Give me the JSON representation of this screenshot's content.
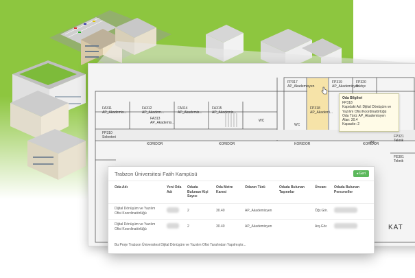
{
  "plan": {
    "rooms": [
      {
        "id": "fp317",
        "code": "FP317",
        "type": "AP_Akademisyen"
      },
      {
        "id": "fp318",
        "code": "FP318",
        "type": "AP_Akademisyen"
      },
      {
        "id": "fp319",
        "code": "FP319",
        "type": "AP_Akademisyen"
      },
      {
        "id": "fp320",
        "code": "FP320",
        "type": "Büdçe"
      },
      {
        "id": "fa311",
        "code": "FA311",
        "type": "AP_Akademis..."
      },
      {
        "id": "fa312",
        "code": "FA312",
        "type": "AP_Akadem..."
      },
      {
        "id": "fa313",
        "code": "FA313",
        "type": "AP_Akademis..."
      },
      {
        "id": "fa314",
        "code": "FA314",
        "type": "AP_Akademis..."
      },
      {
        "id": "fa315",
        "code": "FA315",
        "type": "AP_Akademis..."
      },
      {
        "id": "fp310",
        "code": "FP310",
        "type": "Sekreteri"
      },
      {
        "id": "fp321",
        "code": "FP321",
        "type": "Teknik"
      },
      {
        "id": "fe301",
        "code": "FE301",
        "type": "Teknik"
      }
    ],
    "selected": {
      "id": "fp318",
      "code": "FP318",
      "type": "AP_Akademi..."
    },
    "corridors": [
      "KORIDOR",
      "KORIDOR",
      "KORIDOR",
      "KORIDOR"
    ],
    "wc_labels": [
      "WC",
      "WC",
      "WC"
    ],
    "floor_label": "KAT"
  },
  "tooltip": {
    "title": "Oda Bilgileri",
    "lines": [
      "FP318",
      "Kapıdaki Ad: Dijital Dönüşüm ve",
      "Yazılım Ofisi Koordinatörlüğü",
      "Oda Türü: AP_Akademisyen",
      "Alan: 30.4",
      "Kapasite: 2"
    ]
  },
  "card": {
    "title": "Trabzon Üniversitesi Fatih Kampüsü",
    "button": "Geri",
    "columns": [
      "Oda Adı",
      "Yeni Oda Adı",
      "Odada Bulunan Kişi Sayısı",
      "Oda Metre Karesi",
      "Odanın Türü",
      "Odada Bulunan Taşınırlar",
      "Ünvanı",
      "Odada Bulunan Personeller"
    ],
    "rows": [
      {
        "oda_adi": "Dijital Dönüşüm ve Yazılım Ofisi Koordinatörlüğü",
        "kisi": "2",
        "metre": "30.40",
        "tur": "AP_Akademisyen",
        "unvan": "Öğr.Gör."
      },
      {
        "oda_adi": "Dijital Dönüşüm ve Yazılım Ofisi Koordinatörlüğü",
        "kisi": "2",
        "metre": "30.40",
        "tur": "AP_Akademisyen",
        "unvan": "Arş.Gör."
      }
    ],
    "footer": "Bu Proje Trabzon Üniversitesi Dijital Dönüşüm ve Yazılım Ofisi Tarafından Yapılmıştır..."
  },
  "colors": {
    "brand_green": "#8dc63f",
    "button_green": "#5cb85c",
    "selected_room": "#f6e3a8"
  }
}
